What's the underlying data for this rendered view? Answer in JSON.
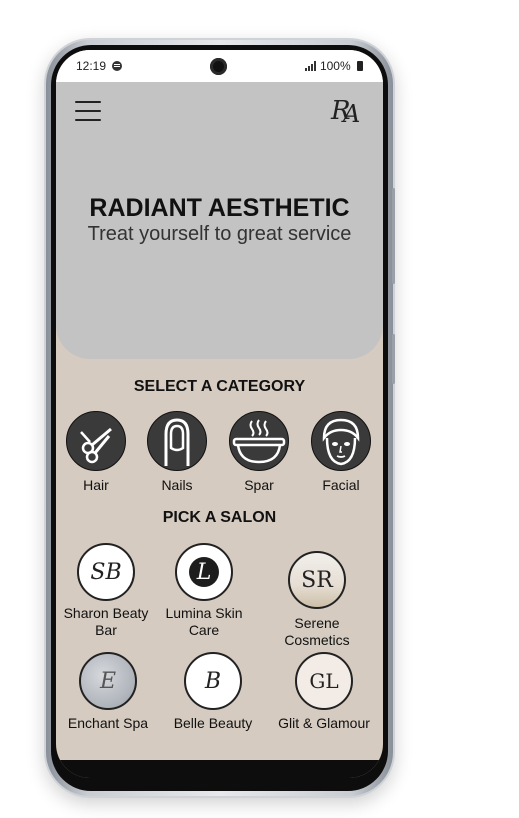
{
  "status_bar": {
    "time": "12:19",
    "battery": "100%"
  },
  "header": {
    "logo_text": "RA",
    "title": "RADIANT AESTHETIC",
    "subtitle": "Treat yourself to great service"
  },
  "categories_section": {
    "title": "SELECT A CATEGORY",
    "items": [
      {
        "label": "Hair",
        "icon": "scissors-icon"
      },
      {
        "label": "Nails",
        "icon": "nail-icon"
      },
      {
        "label": "Spar",
        "icon": "spa-bowl-icon"
      },
      {
        "label": "Facial",
        "icon": "face-mask-icon"
      }
    ]
  },
  "salons_section": {
    "title": "PICK A SALON",
    "items": [
      {
        "label": "Sharon Beaty Bar",
        "monogram": "SB"
      },
      {
        "label": "Lumina Skin Care",
        "monogram": "L"
      },
      {
        "label": "Serene Cosmetics",
        "monogram": "SR"
      },
      {
        "label": "Enchant Spa",
        "monogram": "E"
      },
      {
        "label": "Belle Beauty",
        "monogram": "B"
      },
      {
        "label": "Glit & Glamour",
        "monogram": "GL"
      }
    ]
  },
  "colors": {
    "hero_bg": "#c3c3c4",
    "body_bg": "#d5cbc0",
    "icon_bg": "#3a3a3a"
  }
}
